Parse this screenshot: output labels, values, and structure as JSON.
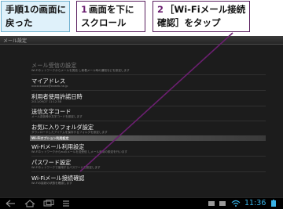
{
  "callouts": [
    {
      "step": "",
      "text_line1": "手順1の画面に",
      "text_line2": "戻った"
    },
    {
      "step": "1",
      "text_line1": "画面を下に",
      "text_line2": "スクロール"
    },
    {
      "step": "2",
      "text_line1": "［Wi-Fiメール接続",
      "text_line2": "確認］をタップ"
    }
  ],
  "titlebar": {
    "title": "メール設定"
  },
  "settings": {
    "items": [
      {
        "title": "メール受信の設定",
        "summary": "Wi-Fiネットワークからメールを受信 し新着メール時の通知などを設定します"
      },
      {
        "title": "マイアドレス",
        "summary": "xxxxxxxxxx@ezweb.ne.jp"
      },
      {
        "title": "利用者使用許諾日時",
        "summary": "2011/09/27 11:12:38"
      },
      {
        "title": "送信文字コード",
        "summary": "メール送信時の文字コードを設定します"
      },
      {
        "title": "お気に入りフォルダ設定",
        "summary": "ダウンロードしたアイテムを保存するフォルダを設定します"
      }
    ],
    "section_header": "Wi-Fiオプション利用設定",
    "wifi_items": [
      {
        "title": "Wi-Fiメール利用設定",
        "summary": "Wi-Fiネットワークからauのメールを送受信 しメール利用の設定を行います"
      },
      {
        "title": "パスワード設定",
        "summary": "Wi-Fiネットワークで使用するパスワードを設定します"
      },
      {
        "title": "Wi-Fiメール接続確認",
        "summary": "Wi-Fiの接続の状態を確認します"
      }
    ]
  },
  "navbar": {
    "back_icon": "back-icon",
    "home_icon": "home-icon",
    "recent_icon": "recent-apps-icon",
    "menu_icon": "menu-icon",
    "clock": "11:36"
  },
  "colors": {
    "accent": "#38b2e6",
    "step": "#6b1f70",
    "callout_border": "#5a1f5f"
  }
}
